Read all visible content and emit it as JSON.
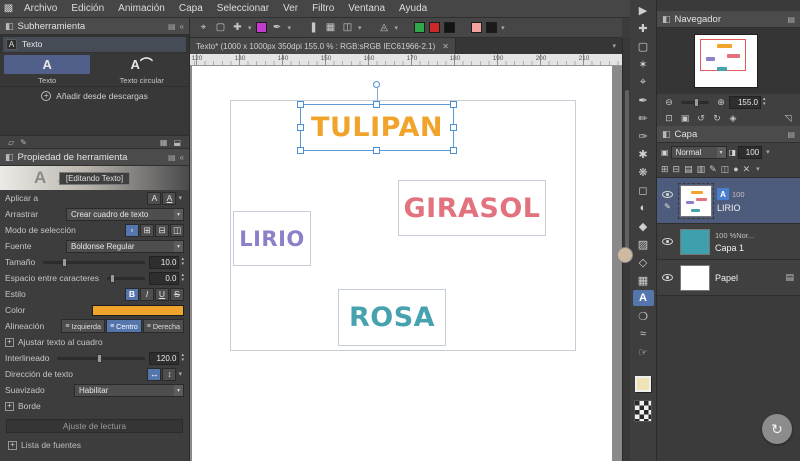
{
  "icons": {
    "close": "✕",
    "plus": "+",
    "chevron_down": "▾"
  },
  "menubar": {
    "items": [
      "Archivo",
      "Edición",
      "Animación",
      "Capa",
      "Seleccionar",
      "Ver",
      "Filtro",
      "Ventana",
      "Ayuda"
    ]
  },
  "toolbar": {
    "swatches": [
      "#c43bd0",
      "#2fa84c",
      "#cc2a2a",
      "#141414",
      "#f2a3a0",
      "#1a1a1a"
    ]
  },
  "left_panel": {
    "subtool_panel": {
      "title": "Subherramienta",
      "group_label": "Texto",
      "tiles": [
        {
          "label": "Texto",
          "selected": true
        },
        {
          "label": "Texto circular",
          "selected": false
        }
      ],
      "add_downloads": "Añadir desde descargas"
    },
    "tool_property_panel": {
      "title": "Propiedad de herramienta",
      "editing_badge": "[Editando Texto]",
      "rows": {
        "aplicar": {
          "label": "Aplicar a"
        },
        "arrastrar": {
          "label": "Arrastrar",
          "value": "Crear cuadro de texto"
        },
        "modo": {
          "label": "Modo de selección"
        },
        "fuente": {
          "label": "Fuente",
          "value": "Boldonse Regular"
        },
        "tamano": {
          "label": "Tamaño",
          "value": "10.0"
        },
        "espacio": {
          "label": "Espacio entre caracteres",
          "value": "0.0"
        },
        "estilo": {
          "label": "Estilo",
          "buttons": [
            "B",
            "I",
            "U",
            "S"
          ]
        },
        "color": {
          "label": "Color",
          "value": "#f0a42c"
        },
        "alineacion": {
          "label": "Alineación",
          "options": [
            "Izquierda",
            "Centro",
            "Derecha"
          ],
          "selected": "Centro"
        },
        "ajustar": {
          "label": "Ajustar texto al cuadro"
        },
        "interlineado": {
          "label": "Interlineado",
          "value": "120.0"
        },
        "direccion": {
          "label": "Dirección de texto"
        },
        "suavizado": {
          "label": "Suavizado",
          "value": "Habilitar"
        },
        "borde": {
          "label": "Borde"
        }
      },
      "footer": {
        "reading": "Ajuste de lectura",
        "font_list": "Lista de fuentes"
      }
    }
  },
  "canvas": {
    "tab_title": "Texto* (1000 x 1000px 350dpi 155.0 % : RGB:sRGB IEC61966-2.1)",
    "ruler_labels": [
      "120",
      "130",
      "140",
      "150",
      "160",
      "170",
      "180",
      "190",
      "200",
      "210"
    ],
    "words": [
      {
        "text": "TULIPAN",
        "color": "#f0a42c",
        "selected": true
      },
      {
        "text": "GIRASOL",
        "color": "#e2737e",
        "selected": false
      },
      {
        "text": "LIRIO",
        "color": "#8d80c9",
        "selected": false
      },
      {
        "text": "ROSA",
        "color": "#47a2b0",
        "selected": false
      }
    ]
  },
  "right_panel": {
    "navigator": {
      "title": "Navegador",
      "zoom_value": "155.0"
    },
    "layer_panel": {
      "title": "Capa",
      "blend_mode": "Normal",
      "opacity": "100",
      "layers": [
        {
          "name": "LIRIO",
          "badge": "A",
          "opacity": "100",
          "selected": true
        },
        {
          "name": "Capa 1",
          "info": "100 %Nor...",
          "color": "#3fa0ad",
          "selected": false
        },
        {
          "name": "Papel",
          "selected": false
        }
      ]
    }
  },
  "tool_strip": {
    "selected_tool": "Texto",
    "fg_color": "#f1e3b5"
  }
}
